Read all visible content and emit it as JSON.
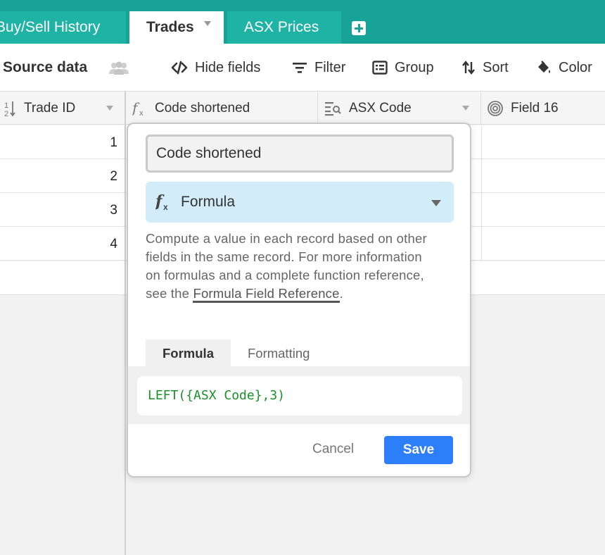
{
  "tabs": [
    {
      "label": "Buy/Sell History",
      "active": false
    },
    {
      "label": "Trades",
      "active": true
    },
    {
      "label": "ASX Prices",
      "active": false
    }
  ],
  "toolbar": {
    "view_name": "Source data",
    "hide_fields": "Hide fields",
    "filter": "Filter",
    "group": "Group",
    "sort": "Sort",
    "color": "Color"
  },
  "columns": [
    {
      "label": "Trade ID",
      "icon": "number-icon"
    },
    {
      "label": "Code shortened",
      "icon": "formula-icon"
    },
    {
      "label": "ASX Code",
      "icon": "lookup-icon"
    },
    {
      "label": "Field 16",
      "icon": "spiral-icon"
    }
  ],
  "rows": [
    {
      "trade_id": "1"
    },
    {
      "trade_id": "2"
    },
    {
      "trade_id": "3"
    },
    {
      "trade_id": "4"
    }
  ],
  "popover": {
    "field_name": "Code shortened",
    "field_type": "Formula",
    "description": "Compute a value in each record based on other fields in the same record. For more information on formulas and a complete function reference, see the",
    "link_text": "Formula Field Reference",
    "description_end": ".",
    "tabs": [
      "Formula",
      "Formatting"
    ],
    "formula": "LEFT({ASX Code},3)",
    "cancel": "Cancel",
    "save": "Save"
  },
  "colors": {
    "tabbar": "#17a398",
    "accent": "#2d7ff9",
    "formula_text": "#1a8f2a",
    "type_select_bg": "#d2edf9"
  }
}
